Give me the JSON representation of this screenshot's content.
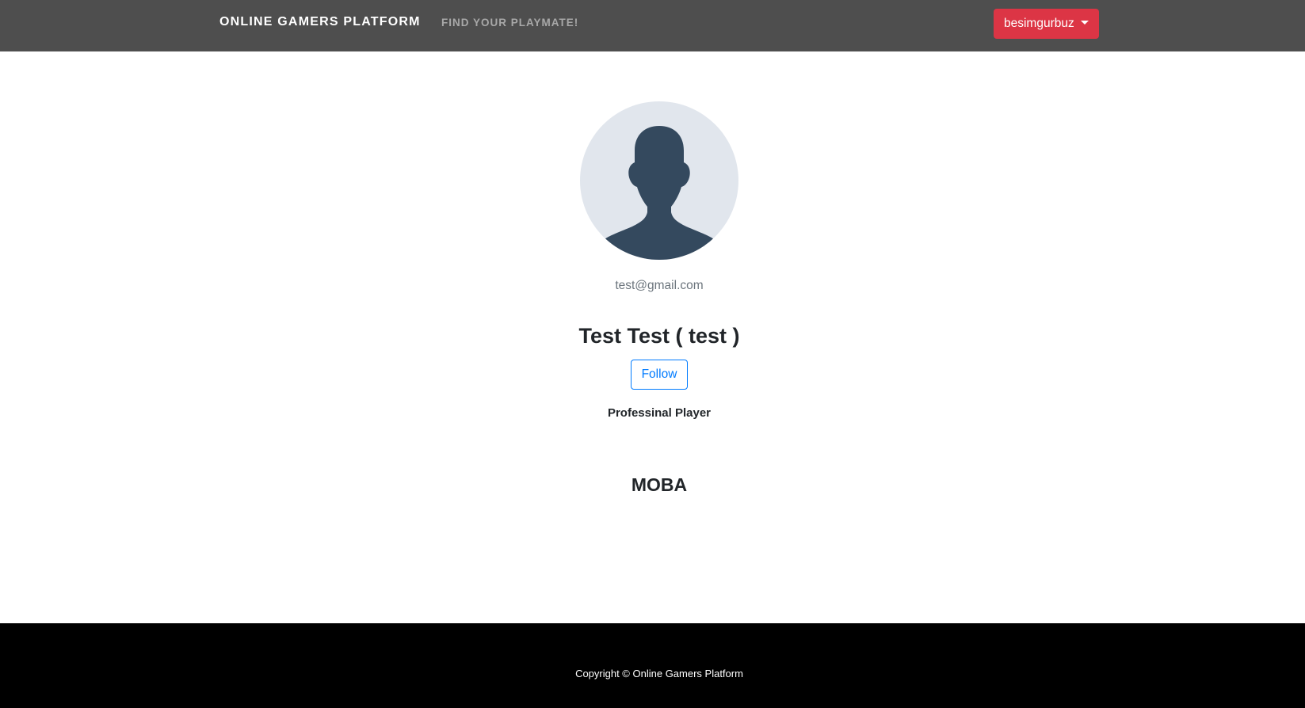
{
  "navbar": {
    "brand": "ONLINE GAMERS PLATFORM",
    "link": "FIND YOUR PLAYMATE!",
    "user_menu_label": "besimgurbuz",
    "user_menu_color": "#dc3545",
    "background": "#4e4e4e"
  },
  "profile": {
    "avatar_icon": "user-silhouette-icon",
    "email": "test@gmail.com",
    "display_name": "Test Test ( test )",
    "follow_label": "Follow",
    "bio": "Professinal Player",
    "genre": "MOBA"
  },
  "footer": {
    "copyright": "Copyright © Online Gamers Platform"
  }
}
